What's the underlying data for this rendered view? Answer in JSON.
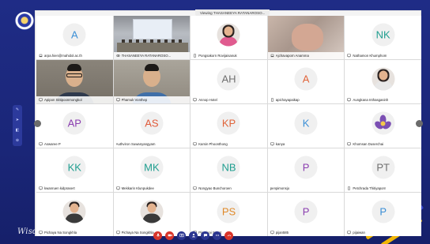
{
  "window": {
    "title": "Viewing THASANEEYA RATANAROSO..."
  },
  "wallpaper": {
    "signature": "Wisdom of the Land"
  },
  "colors": {
    "avatar_text": {
      "A": "#3b8fd6",
      "NK": "#1f9e8f",
      "AH": "#6f6f6f",
      "A2": "#e0643a",
      "AP": "#8b3fb0",
      "AS": "#e05a3a",
      "KP": "#e0643a",
      "K": "#3b8fd6",
      "KK": "#1f9e8f",
      "MK": "#1f9e8f",
      "NB": "#1f9e8f",
      "P": "#8b3fb0",
      "PT": "#6f6f6f",
      "PS": "#e08a2a",
      "P2": "#3b8fd6"
    }
  },
  "tiles": [
    {
      "kind": "initials",
      "initials": "A",
      "color_key": "A",
      "name": "arpa.hien@mahidol.ac.th",
      "icon": "laptop-icon",
      "muted": true
    },
    {
      "kind": "video",
      "scene": "classroom",
      "name": "THASANEEYA RATANAROSO...",
      "icon": "link-icon",
      "muted": false
    },
    {
      "kind": "photo",
      "photo": "female-pink",
      "name": "Pongsakorn Rovijaisanuk",
      "icon": "phone-icon",
      "muted": true
    },
    {
      "kind": "video",
      "scene": "closeup",
      "name": "Ajchavaporn Anamma",
      "icon": "laptop-icon",
      "muted": true
    },
    {
      "kind": "initials",
      "initials": "NK",
      "color_key": "NK",
      "name": "Nathamon Khumphom",
      "icon": "desktop-icon",
      "muted": true
    },
    {
      "kind": "video",
      "scene": "webcam-a",
      "name": "Apipon Sittipoonmongkol",
      "icon": "desktop-icon",
      "muted": true
    },
    {
      "kind": "video",
      "scene": "webcam-b",
      "name": "Phamuk Vonthep",
      "icon": "desktop-icon",
      "muted": true
    },
    {
      "kind": "initials",
      "initials": "AH",
      "color_key": "AH",
      "name": "Annop Hotel",
      "icon": "desktop-icon",
      "muted": true
    },
    {
      "kind": "initials",
      "initials": "A",
      "color_key": "A2",
      "name": "apichayapaikap",
      "icon": "phone-icon",
      "muted": true
    },
    {
      "kind": "photo",
      "photo": "female",
      "name": "Aungkana Inthasgasinh",
      "icon": "desktop-icon",
      "muted": true
    },
    {
      "kind": "initials",
      "initials": "AP",
      "color_key": "AP",
      "name": "Aswaree P",
      "icon": "desktop-icon",
      "muted": true
    },
    {
      "kind": "initials",
      "initials": "AS",
      "color_key": "AS",
      "name": "Authviron Suwanyangyam",
      "icon": "",
      "muted": false
    },
    {
      "kind": "initials",
      "initials": "KP",
      "color_key": "KP",
      "name": "Karsin Phoonthong",
      "icon": "desktop-icon",
      "muted": true
    },
    {
      "kind": "initials",
      "initials": "K",
      "color_key": "K",
      "name": "kanya",
      "icon": "desktop-icon",
      "muted": true
    },
    {
      "kind": "logo",
      "name": "Khomsan Duserchai",
      "icon": "desktop-icon",
      "muted": true
    },
    {
      "kind": "initials",
      "initials": "KK",
      "color_key": "KK",
      "name": "kwanruen kidprasert",
      "icon": "desktop-icon",
      "muted": false
    },
    {
      "kind": "initials",
      "initials": "MK",
      "color_key": "MK",
      "name": "Mekkarin Klunpukdee",
      "icon": "desktop-icon",
      "muted": true
    },
    {
      "kind": "initials",
      "initials": "NB",
      "color_key": "NB",
      "name": "Nongyao Bunchoroen",
      "icon": "desktop-icon",
      "muted": true
    },
    {
      "kind": "initials",
      "initials": "P",
      "color_key": "P",
      "name": "penpimonsjo",
      "icon": "",
      "muted": false
    },
    {
      "kind": "initials",
      "initials": "PT",
      "color_key": "PT",
      "name": "Petchrada Thitiyaporn",
      "icon": "phone-icon",
      "muted": true
    },
    {
      "kind": "photo",
      "photo": "male",
      "name": "Pichaya Na Songkhla",
      "icon": "desktop-icon",
      "muted": true
    },
    {
      "kind": "photo",
      "photo": "male",
      "name": "Pichaya Na Songkhla",
      "icon": "desktop-icon",
      "muted": true
    },
    {
      "kind": "initials",
      "initials": "PS",
      "color_key": "PS",
      "name": "Pimpinai Supat",
      "icon": "desktop-icon",
      "muted": true
    },
    {
      "kind": "initials",
      "initials": "P",
      "color_key": "P",
      "name": "pijan585",
      "icon": "desktop-icon",
      "muted": true
    },
    {
      "kind": "initials",
      "initials": "P",
      "color_key": "P2",
      "name": "pijaiwan",
      "icon": "desktop-icon",
      "muted": true
    }
  ],
  "controls": [
    {
      "name": "mic-button",
      "icon": "mic-icon",
      "red": true
    },
    {
      "name": "video-button",
      "icon": "video-icon",
      "red": true
    },
    {
      "name": "share-button",
      "icon": "share-icon",
      "red": false
    },
    {
      "name": "participants-button",
      "icon": "participants-icon",
      "red": false
    },
    {
      "name": "chat-button",
      "icon": "chat-icon",
      "red": false
    },
    {
      "name": "more-button",
      "icon": "more-icon",
      "red": false
    },
    {
      "name": "leave-button",
      "icon": "leave-icon",
      "red": true
    }
  ]
}
